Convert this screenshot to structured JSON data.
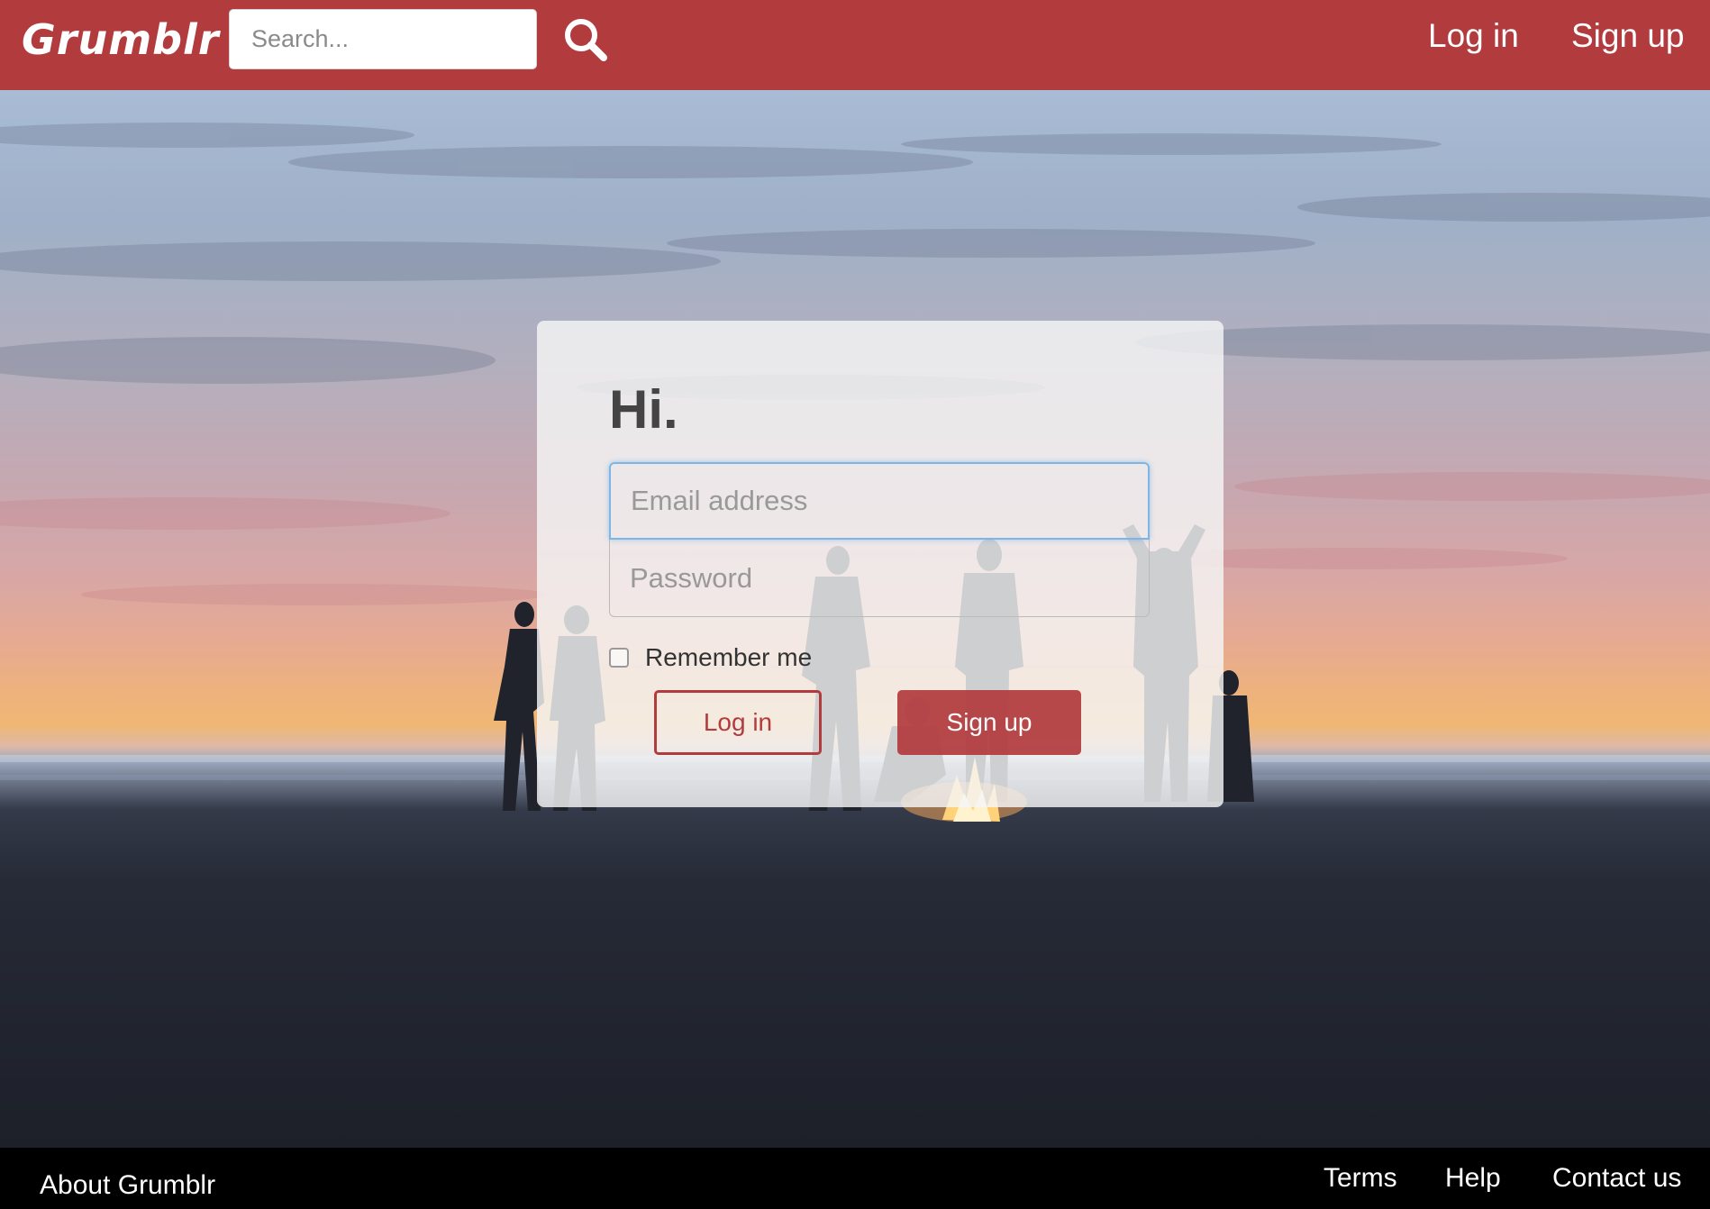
{
  "navbar": {
    "brand": "Grumblr",
    "search_placeholder": "Search...",
    "search_icon": "search-icon",
    "login_label": "Log in",
    "signup_label": "Sign up"
  },
  "hero": {
    "background": "beach bonfire at sunset"
  },
  "login_card": {
    "title": "Hi.",
    "email_placeholder": "Email address",
    "password_placeholder": "Password",
    "remember_label": "Remember me",
    "remember_checked": false,
    "login_button": "Log in",
    "signup_button": "Sign up"
  },
  "footer": {
    "about": "About Grumblr",
    "terms": "Terms",
    "help": "Help",
    "contact": "Contact us"
  },
  "colors": {
    "brand": "#b23b3e",
    "footer_bg": "#000000",
    "focus": "#7fb5e4"
  }
}
